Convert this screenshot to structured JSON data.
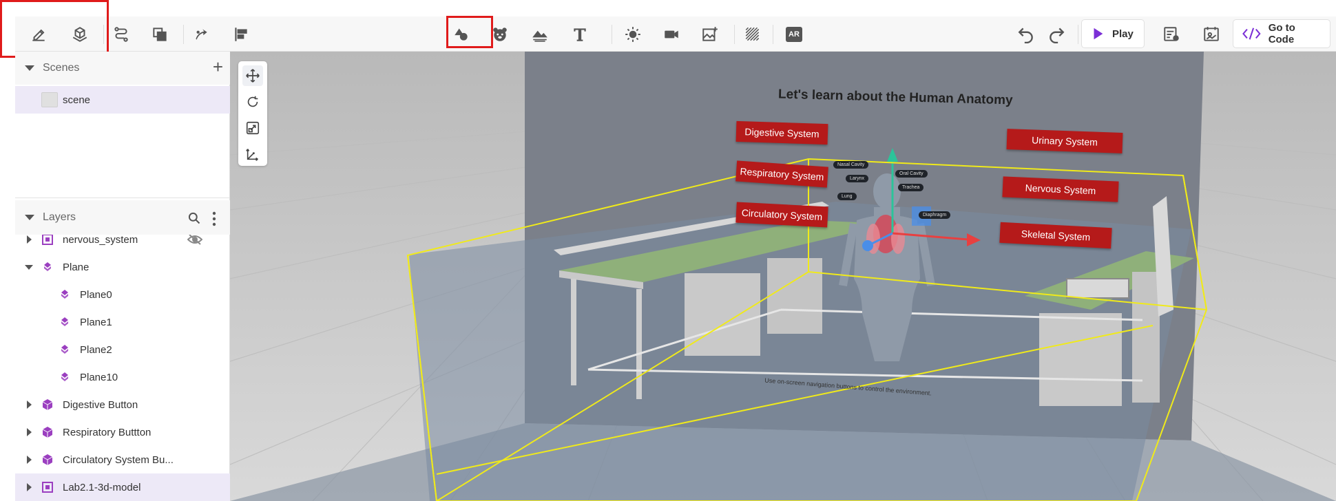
{
  "toolbar": {
    "left_tools": [
      {
        "name": "edit-icon"
      },
      {
        "name": "place-object-icon"
      },
      {
        "name": "path-icon"
      },
      {
        "name": "layers-copy-icon"
      },
      {
        "name": "animate-icon"
      },
      {
        "name": "align-icon"
      }
    ],
    "center_tools": [
      {
        "name": "shapes-icon"
      },
      {
        "name": "character-icon"
      },
      {
        "name": "environment-icon"
      },
      {
        "name": "text-icon"
      },
      {
        "name": "light-icon"
      },
      {
        "name": "camera-icon"
      },
      {
        "name": "image-icon"
      },
      {
        "name": "texture-icon"
      },
      {
        "name": "ar-icon",
        "text": "AR"
      }
    ],
    "play_label": "Play",
    "code_label": "Go to Code",
    "highlight_color": "#e01b1b"
  },
  "scenes": {
    "title": "Scenes",
    "items": [
      {
        "label": "scene",
        "selected": true
      }
    ]
  },
  "layers": {
    "title": "Layers",
    "items": [
      {
        "label": "nervous_system",
        "icon": "group-icon",
        "expander": "collapsed",
        "level": 0
      },
      {
        "label": "Plane",
        "icon": "mesh-icon",
        "expander": "expanded",
        "level": 0
      },
      {
        "label": "Plane0",
        "icon": "mesh-icon",
        "expander": "none",
        "level": 1
      },
      {
        "label": "Plane1",
        "icon": "mesh-icon",
        "expander": "none",
        "level": 1
      },
      {
        "label": "Plane2",
        "icon": "mesh-icon",
        "expander": "none",
        "level": 1
      },
      {
        "label": "Plane10",
        "icon": "mesh-icon",
        "expander": "none",
        "level": 1
      },
      {
        "label": "Digestive Button",
        "icon": "cube-icon",
        "expander": "collapsed",
        "level": 0
      },
      {
        "label": "Respiratory Buttton",
        "icon": "cube-icon",
        "expander": "collapsed",
        "level": 0
      },
      {
        "label": "Circulatory System Bu...",
        "icon": "cube-icon",
        "expander": "collapsed",
        "level": 0
      },
      {
        "label": "Lab2.1-3d-model",
        "icon": "group-icon",
        "expander": "collapsed",
        "level": 0,
        "selected": true
      }
    ]
  },
  "scene": {
    "title": "Let's learn about the Human Anatomy",
    "buttons_left": [
      "Digestive System",
      "Respiratory System",
      "Circulatory System"
    ],
    "buttons_right": [
      "Urinary System",
      "Nervous System",
      "Skeletal System"
    ],
    "organ_labels": [
      "Nasal Cavity",
      "Larynx",
      "Lung",
      "Oral Cavity",
      "Trachea",
      "Diaphragm"
    ],
    "floor_text": "Use on-screen navigation buttons to control the environment.",
    "selection_color": "#f0ea1a",
    "button_color": "#b51a1a",
    "accent": "#7b2fd6"
  }
}
